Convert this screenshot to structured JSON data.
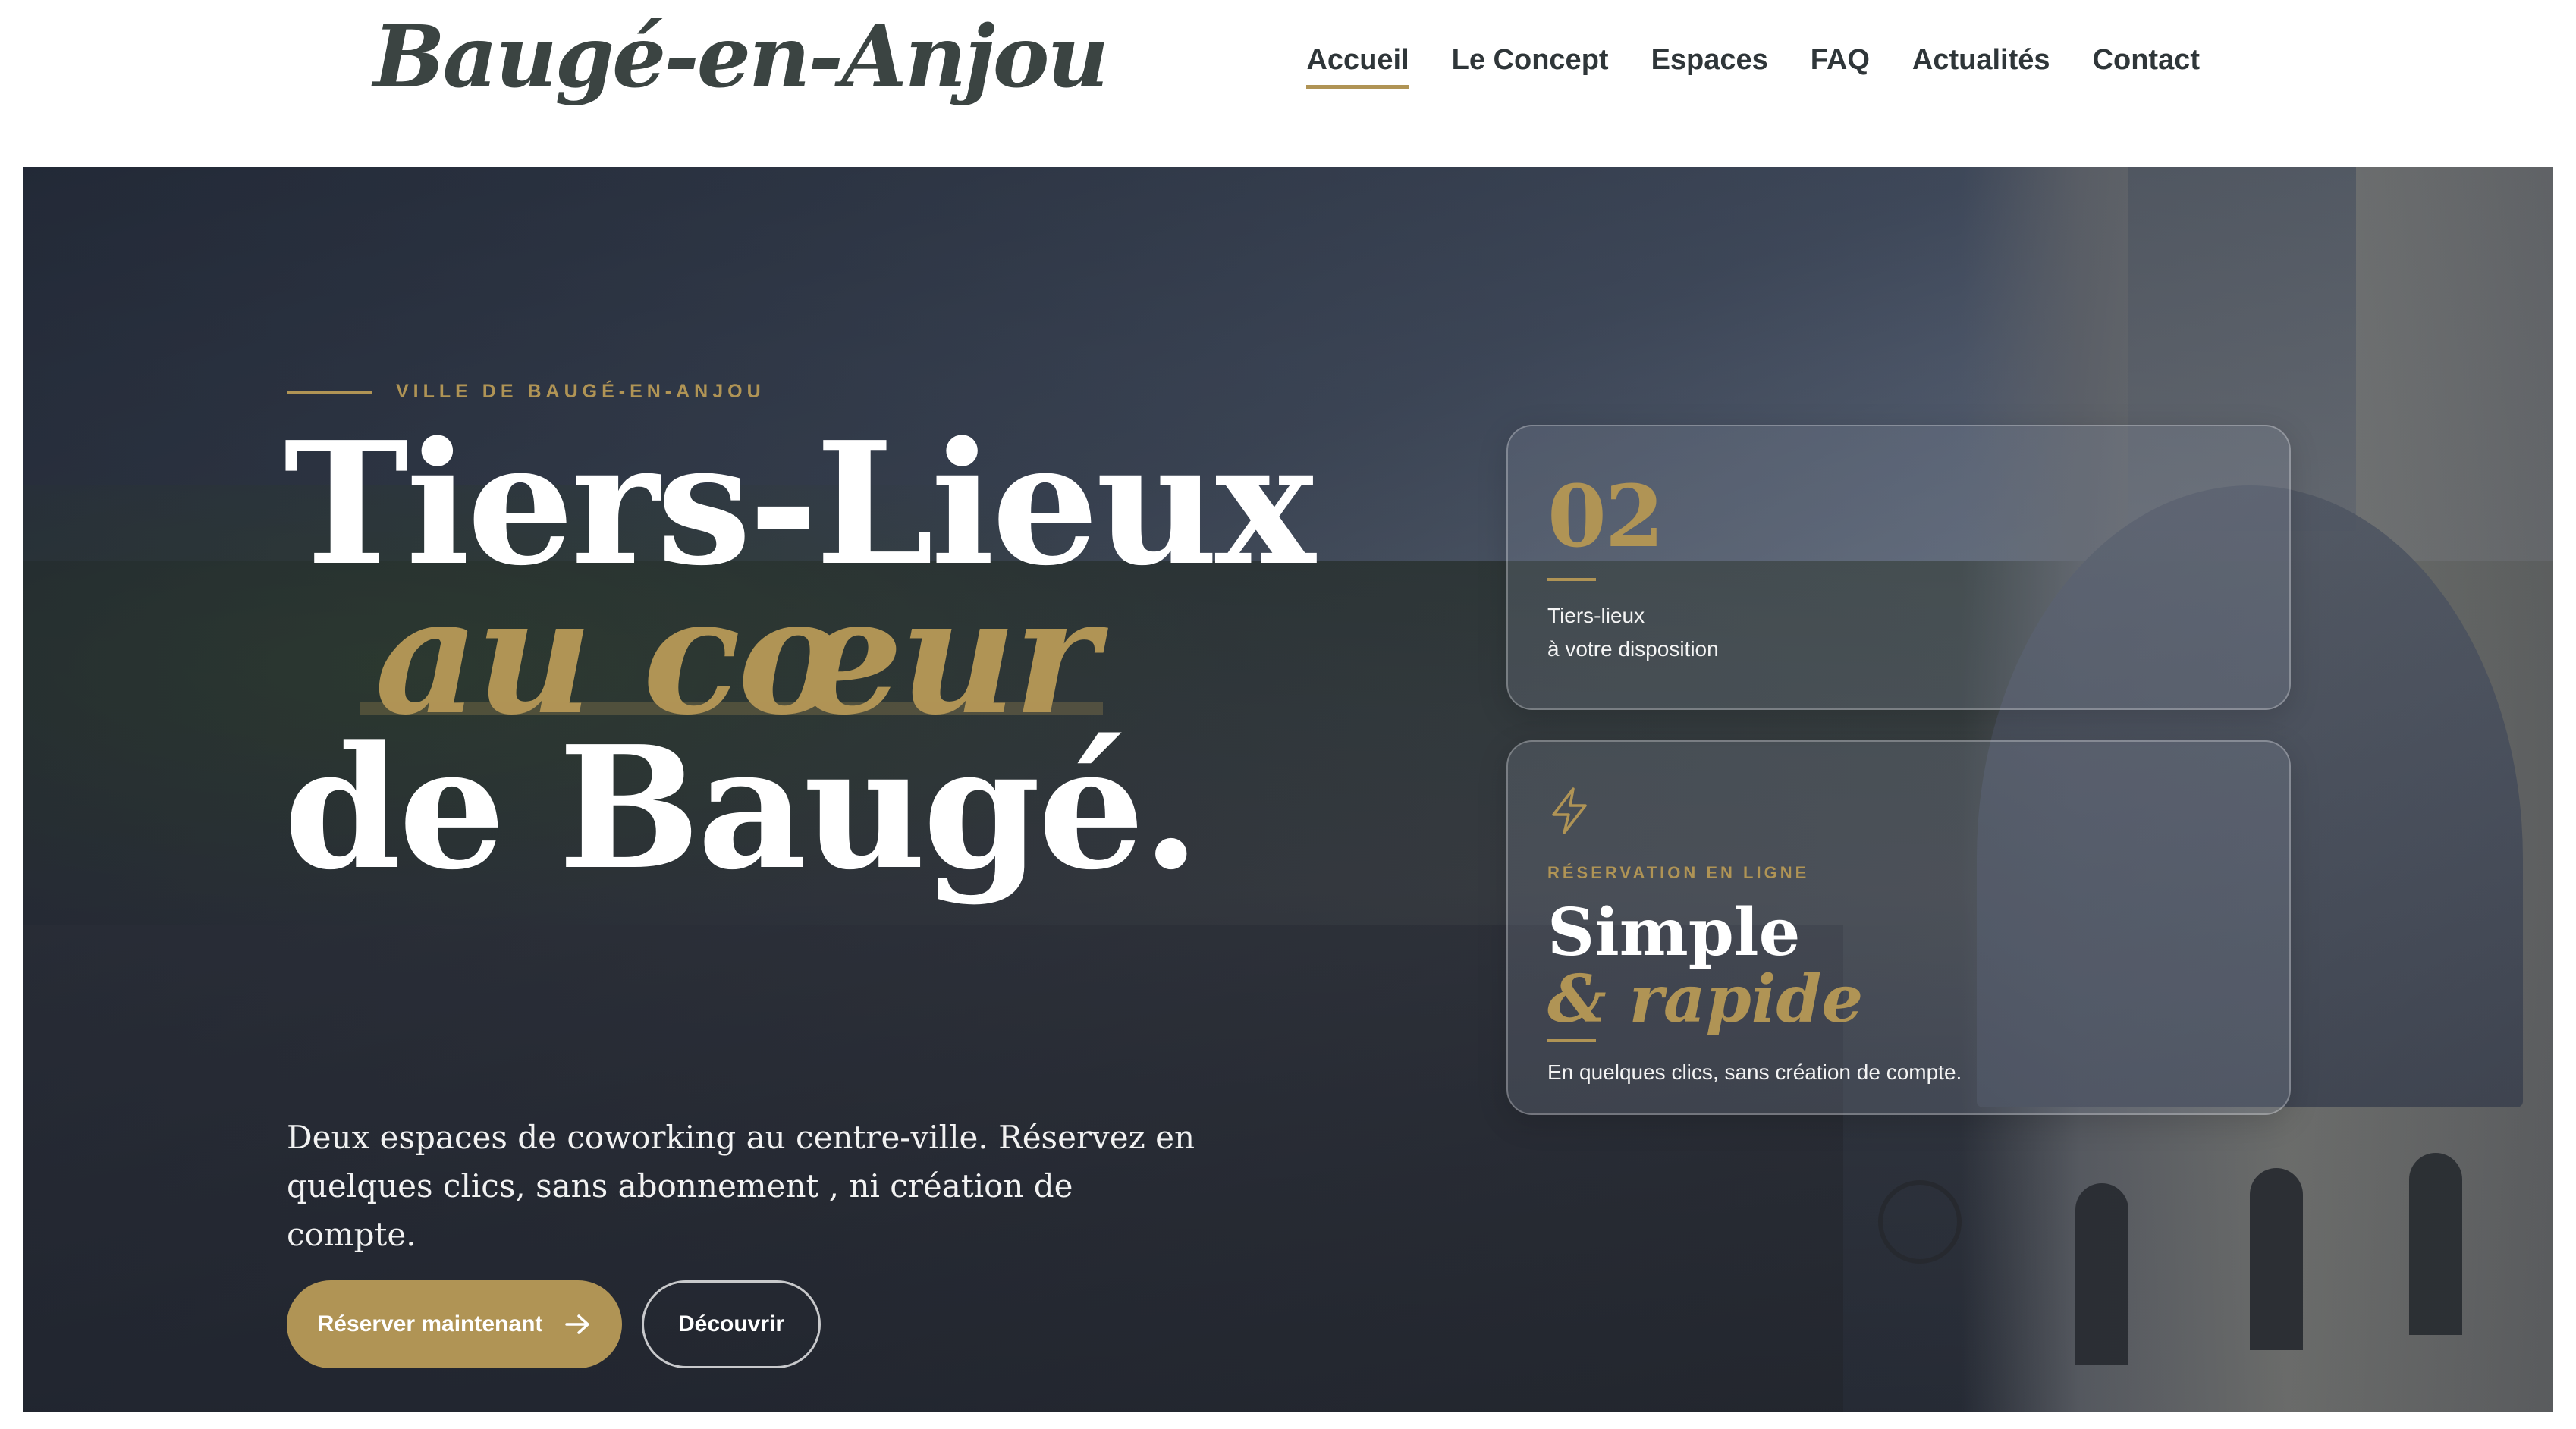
{
  "brand": {
    "logo_text": "Baugé-en-Anjou"
  },
  "nav": {
    "items": [
      {
        "label": "Accueil",
        "active": true
      },
      {
        "label": "Le Concept",
        "active": false
      },
      {
        "label": "Espaces",
        "active": false
      },
      {
        "label": "FAQ",
        "active": false
      },
      {
        "label": "Actualités",
        "active": false
      },
      {
        "label": "Contact",
        "active": false
      }
    ]
  },
  "hero": {
    "eyebrow": "VILLE DE BAUGÉ-EN-ANJOU",
    "headline": {
      "line1": "Tiers-Lieux",
      "line2": "au cœur",
      "line3": "de Baugé."
    },
    "lede": "Deux espaces de coworking au centre-ville. Réservez en quelques clics, sans abonnement , ni création de compte.",
    "cta_primary": {
      "label": "Réserver maintenant",
      "icon": "arrow-right-icon"
    },
    "cta_secondary": {
      "label": "Découvrir"
    }
  },
  "cards": {
    "stat": {
      "number": "02",
      "caption_line1": "Tiers-lieux",
      "caption_line2": "à votre disposition"
    },
    "feature": {
      "icon": "lightning-bolt-icon",
      "eyebrow": "RÉSERVATION EN LIGNE",
      "title": "Simple",
      "title_accent": "& rapide",
      "text": "En quelques clics, sans création de compte."
    }
  },
  "colors": {
    "accent_gold": "#b09455",
    "logo_text": "#3b4442",
    "nav_text": "#2f3639",
    "hero_text": "#ffffff"
  }
}
